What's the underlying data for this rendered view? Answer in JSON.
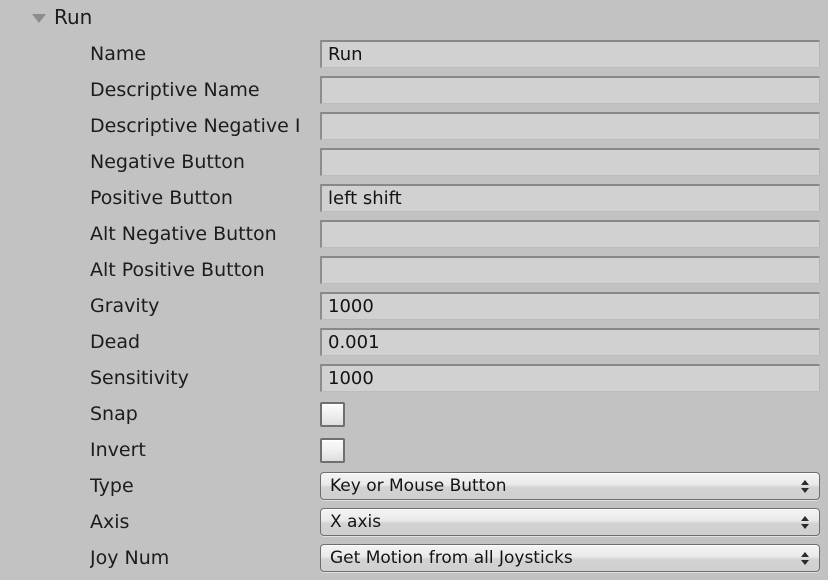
{
  "panel": {
    "foldout": {
      "label": "Run",
      "expanded": true,
      "arrow_icon": "triangle-down-icon"
    },
    "colors": {
      "background": "#c2c2c2",
      "field_fill": "#d1d1d1",
      "text": "#1c1c1c",
      "border_dark": "#6e6e6e"
    },
    "rows": [
      {
        "label": "Name",
        "control": "textfield",
        "value": "Run",
        "placeholder": ""
      },
      {
        "label": "Descriptive Name",
        "control": "textfield",
        "value": "",
        "placeholder": ""
      },
      {
        "label": "Descriptive Negative I",
        "control": "textfield",
        "value": "",
        "placeholder": ""
      },
      {
        "label": "Negative Button",
        "control": "textfield",
        "value": "",
        "placeholder": ""
      },
      {
        "label": "Positive Button",
        "control": "textfield",
        "value": "left shift",
        "placeholder": ""
      },
      {
        "label": "Alt Negative Button",
        "control": "textfield",
        "value": "",
        "placeholder": ""
      },
      {
        "label": "Alt Positive Button",
        "control": "textfield",
        "value": "",
        "placeholder": ""
      },
      {
        "label": "Gravity",
        "control": "textfield",
        "value": "1000",
        "placeholder": ""
      },
      {
        "label": "Dead",
        "control": "textfield",
        "value": "0.001",
        "placeholder": ""
      },
      {
        "label": "Sensitivity",
        "control": "textfield",
        "value": "1000",
        "placeholder": ""
      },
      {
        "label": "Snap",
        "control": "checkbox",
        "checked": false
      },
      {
        "label": "Invert",
        "control": "checkbox",
        "checked": false
      },
      {
        "label": "Type",
        "control": "dropdown",
        "value": "Key or Mouse Button"
      },
      {
        "label": "Axis",
        "control": "dropdown",
        "value": "X axis"
      },
      {
        "label": "Joy Num",
        "control": "dropdown",
        "value": "Get Motion from all Joysticks"
      }
    ]
  }
}
